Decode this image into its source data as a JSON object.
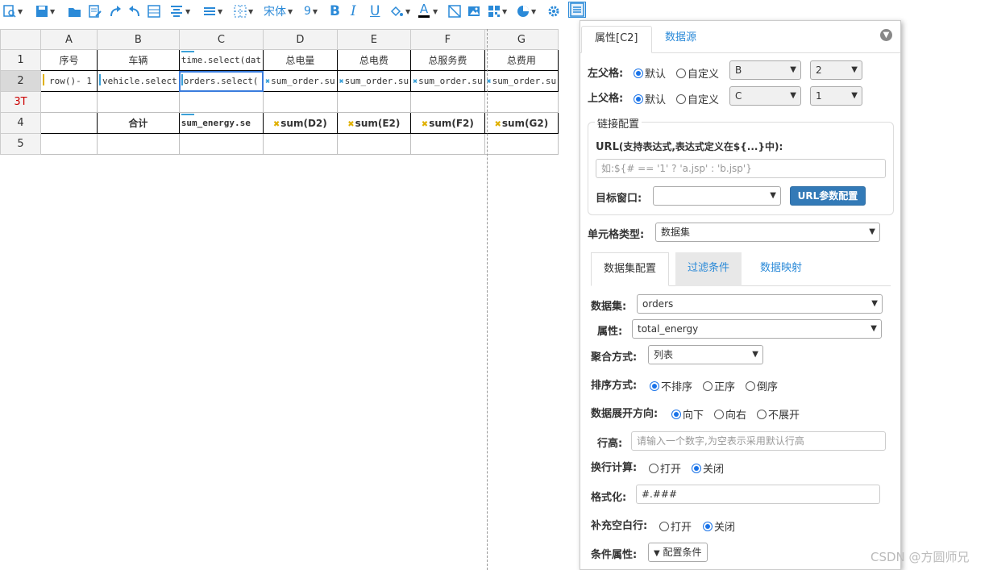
{
  "toolbar": {
    "font_name": "宋体",
    "font_size": "9",
    "bold": "B",
    "italic": "I",
    "underline": "U",
    "font_color": "A"
  },
  "sheet": {
    "columns": [
      "A",
      "B",
      "C",
      "D",
      "E",
      "F",
      "G"
    ],
    "row_headers": [
      "1",
      "2",
      "3T",
      "4",
      "5"
    ],
    "row1": [
      "序号",
      "车辆",
      "time.select(dat",
      "总电量",
      "总电费",
      "总服务费",
      "总费用"
    ],
    "row2": [
      "row()- 1",
      "vehicle.select",
      "orders.select(",
      "sum_order.su",
      "sum_order.su",
      "sum_order.su",
      "sum_order.su"
    ],
    "row4": [
      "",
      "合计",
      "sum_energy.se",
      "sum(D2)",
      "sum(E2)",
      "sum(F2)",
      "sum(G2)"
    ]
  },
  "panel": {
    "tab_props": "属性[C2]",
    "tab_datasource": "数据源",
    "left_parent_label": "左父格:",
    "top_parent_label": "上父格:",
    "default_label": "默认",
    "custom_label": "自定义",
    "left_parent_col": "B",
    "left_parent_row": "2",
    "top_parent_col": "C",
    "top_parent_row": "1",
    "link_legend": "链接配置",
    "url_label": "URL",
    "url_hint": "(支持表达式,表达式定义在${...}中):",
    "url_placeholder": "如:${# == '1' ? 'a.jsp' : 'b.jsp'}",
    "target_label": "目标窗口:",
    "target_value": "",
    "url_param_button": "URL参数配置",
    "cell_type_label": "单元格类型:",
    "cell_type_value": "数据集",
    "subtabs": [
      "数据集配置",
      "过滤条件",
      "数据映射"
    ],
    "dataset_label": "数据集:",
    "dataset_value": "orders",
    "attr_label": "属性:",
    "attr_value": "total_energy",
    "agg_label": "聚合方式:",
    "agg_value": "列表",
    "sort_label": "排序方式:",
    "sort_options": [
      "不排序",
      "正序",
      "倒序"
    ],
    "expand_label": "数据展开方向:",
    "expand_options": [
      "向下",
      "向右",
      "不展开"
    ],
    "row_height_label": "行高:",
    "row_height_placeholder": "请输入一个数字,为空表示采用默认行高",
    "wrap_label": "换行计算:",
    "on_label": "打开",
    "off_label": "关闭",
    "format_label": "格式化:",
    "format_value": "#.###",
    "fill_blank_label": "补充空白行:",
    "cond_label": "条件属性:",
    "cond_button": "配置条件"
  },
  "watermark": "CSDN @方圆师兄"
}
